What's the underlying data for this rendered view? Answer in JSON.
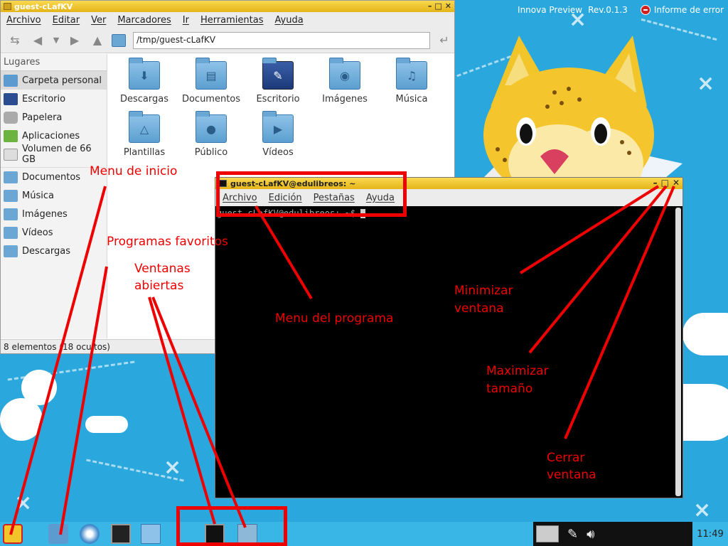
{
  "desktop": {
    "brand": "Innova Preview",
    "version": "Rev.0.1.3",
    "report_label": "Informe de error"
  },
  "file_manager": {
    "title": "guest-cLafKV",
    "menu": [
      "Archivo",
      "Editar",
      "Ver",
      "Marcadores",
      "Ir",
      "Herramientas",
      "Ayuda"
    ],
    "path": "/tmp/guest-cLafKV",
    "places_header": "Lugares",
    "places": [
      "Carpeta personal",
      "Escritorio",
      "Papelera",
      "Aplicaciones",
      "Volumen de 66 GB"
    ],
    "bookmarks": [
      "Documentos",
      "Música",
      "Imágenes",
      "Vídeos",
      "Descargas"
    ],
    "items": [
      "Descargas",
      "Documentos",
      "Escritorio",
      "Imágenes",
      "Música",
      "Plantillas",
      "Público",
      "Vídeos"
    ],
    "status": "8 elementos (18 ocultos)"
  },
  "terminal": {
    "title": "guest-cLafKV@edulibreos: ~",
    "menu": [
      "Archivo",
      "Edición",
      "Pestañas",
      "Ayuda"
    ],
    "prompt": "guest-cLafKV@edulibreos: ~$"
  },
  "taskbar": {
    "clock": "11:49"
  },
  "annotations": {
    "menu_inicio": "Menu de inicio",
    "favoritos": "Programas favoritos",
    "ventanas_1": "Ventanas",
    "ventanas_2": "abiertas",
    "menu_programa": "Menu del programa",
    "minimizar_1": "Minimizar",
    "minimizar_2": "ventana",
    "maximizar_1": "Maximizar",
    "maximizar_2": "tamaño",
    "cerrar_1": "Cerrar",
    "cerrar_2": "ventana"
  },
  "colors": {
    "wallpaper": "#2aa7dc",
    "titlebar": "#f0c530",
    "annotation": "#e00000"
  }
}
